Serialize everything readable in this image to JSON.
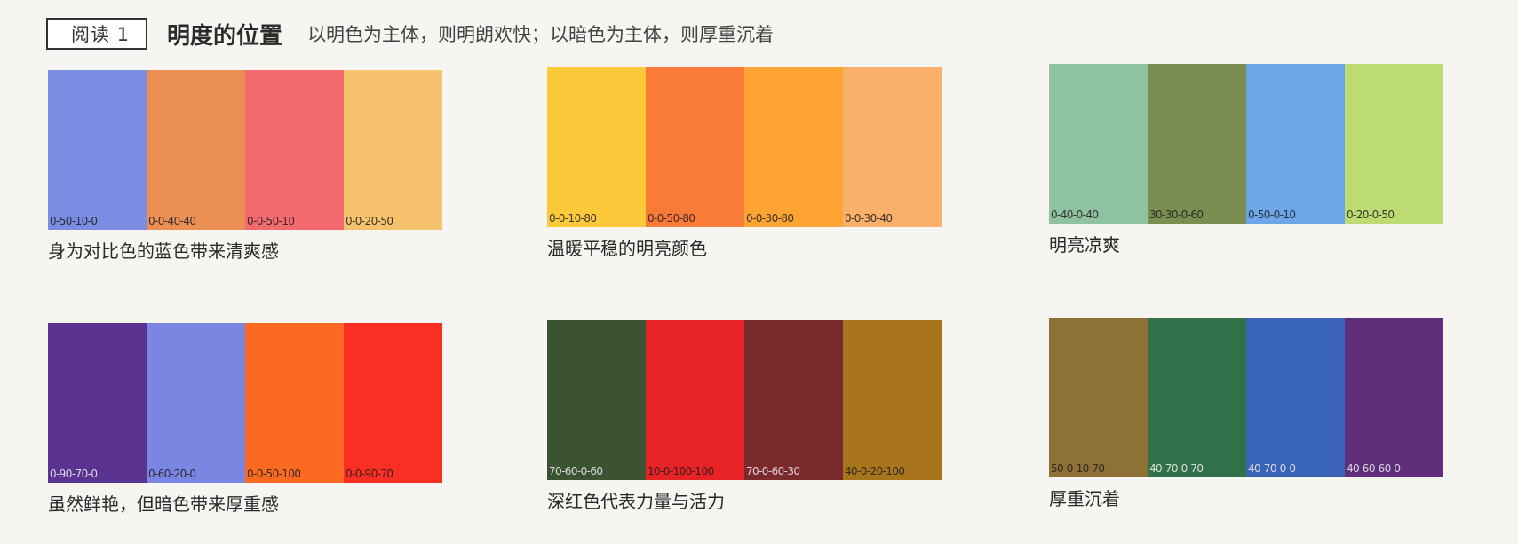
{
  "header": {
    "badge": "阅读 1",
    "title": "明度的位置",
    "subtitle": "以明色为主体，则明朗欢快；以暗色为主体，则厚重沉着"
  },
  "groups": [
    {
      "caption": "身为对比色的蓝色带来清爽感",
      "swatches": [
        {
          "code": "0-50-10-0",
          "color": "#7a8de3"
        },
        {
          "code": "0-0-40-40",
          "color": "#ec8f55"
        },
        {
          "code": "0-0-50-10",
          "color": "#f36a6f"
        },
        {
          "code": "0-0-20-50",
          "color": "#f7c26e"
        }
      ]
    },
    {
      "caption": "温暖平稳的明亮颜色",
      "swatches": [
        {
          "code": "0-0-10-80",
          "color": "#fcc93a"
        },
        {
          "code": "0-0-50-80",
          "color": "#fa7a38"
        },
        {
          "code": "0-0-30-80",
          "color": "#fda432"
        },
        {
          "code": "0-0-30-40",
          "color": "#fab06a"
        }
      ]
    },
    {
      "caption": "明亮凉爽",
      "swatches": [
        {
          "code": "0-40-0-40",
          "color": "#8fc2a0"
        },
        {
          "code": "30-30-0-60",
          "color": "#7b8e51"
        },
        {
          "code": "0-50-0-10",
          "color": "#6da6e9"
        },
        {
          "code": "0-20-0-50",
          "color": "#bcdb73"
        }
      ]
    },
    {
      "caption": "虽然鲜艳，但暗色带来厚重感",
      "swatches": [
        {
          "code": "0-90-70-0",
          "color": "#5a3390",
          "light": true
        },
        {
          "code": "0-60-20-0",
          "color": "#7a86e1"
        },
        {
          "code": "0-0-50-100",
          "color": "#fc6a22"
        },
        {
          "code": "0-0-90-70",
          "color": "#fb2f24"
        }
      ]
    },
    {
      "caption": "深红色代表力量与活力",
      "swatches": [
        {
          "code": "70-60-0-60",
          "color": "#3c5333",
          "light": true
        },
        {
          "code": "10-0-100-100",
          "color": "#e82326"
        },
        {
          "code": "70-0-60-30",
          "color": "#7a2a2c",
          "light": true
        },
        {
          "code": "40-0-20-100",
          "color": "#a8751d"
        }
      ]
    },
    {
      "caption": "厚重沉着",
      "swatches": [
        {
          "code": "50-0-10-70",
          "color": "#8e7135"
        },
        {
          "code": "40-70-0-70",
          "color": "#33714b",
          "light": true
        },
        {
          "code": "40-70-0-0",
          "color": "#3a64b8",
          "light": true
        },
        {
          "code": "40-60-60-0",
          "color": "#5e2e7b",
          "light": true
        }
      ]
    }
  ]
}
